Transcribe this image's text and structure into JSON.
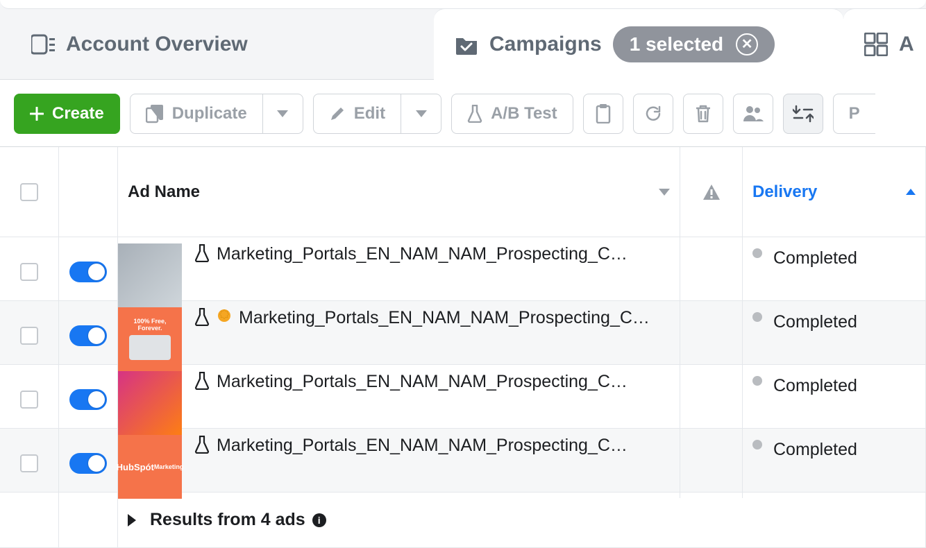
{
  "tabs": {
    "overview": "Account Overview",
    "campaigns": "Campaigns",
    "selected_pill": "1 selected",
    "adsets_prefix": "A"
  },
  "toolbar": {
    "create": "Create",
    "duplicate": "Duplicate",
    "edit": "Edit",
    "abtest": "A/B Test",
    "preview_prefix": "P"
  },
  "columns": {
    "adname": "Ad Name",
    "delivery": "Delivery"
  },
  "rows": [
    {
      "name": "Marketing_Portals_EN_NAM_NAM_Prospecting_Creati…",
      "status": "Completed",
      "gold": false,
      "thumb": "t1",
      "thumb_text": ""
    },
    {
      "name": "Marketing_Portals_EN_NAM_NAM_Prospecting_Cre…",
      "status": "Completed",
      "gold": true,
      "thumb": "t2",
      "thumb_text": "100% Free, Forever."
    },
    {
      "name": "Marketing_Portals_EN_NAM_NAM_Prospecting_Creati…",
      "status": "Completed",
      "gold": false,
      "thumb": "t3",
      "thumb_text": ""
    },
    {
      "name": "Marketing_Portals_EN_NAM_NAM_Prospecting_Creati…",
      "status": "Completed",
      "gold": false,
      "thumb": "t4",
      "thumb_text": "HubSpot Marketing"
    }
  ],
  "footer": {
    "results": "Results from 4 ads"
  }
}
